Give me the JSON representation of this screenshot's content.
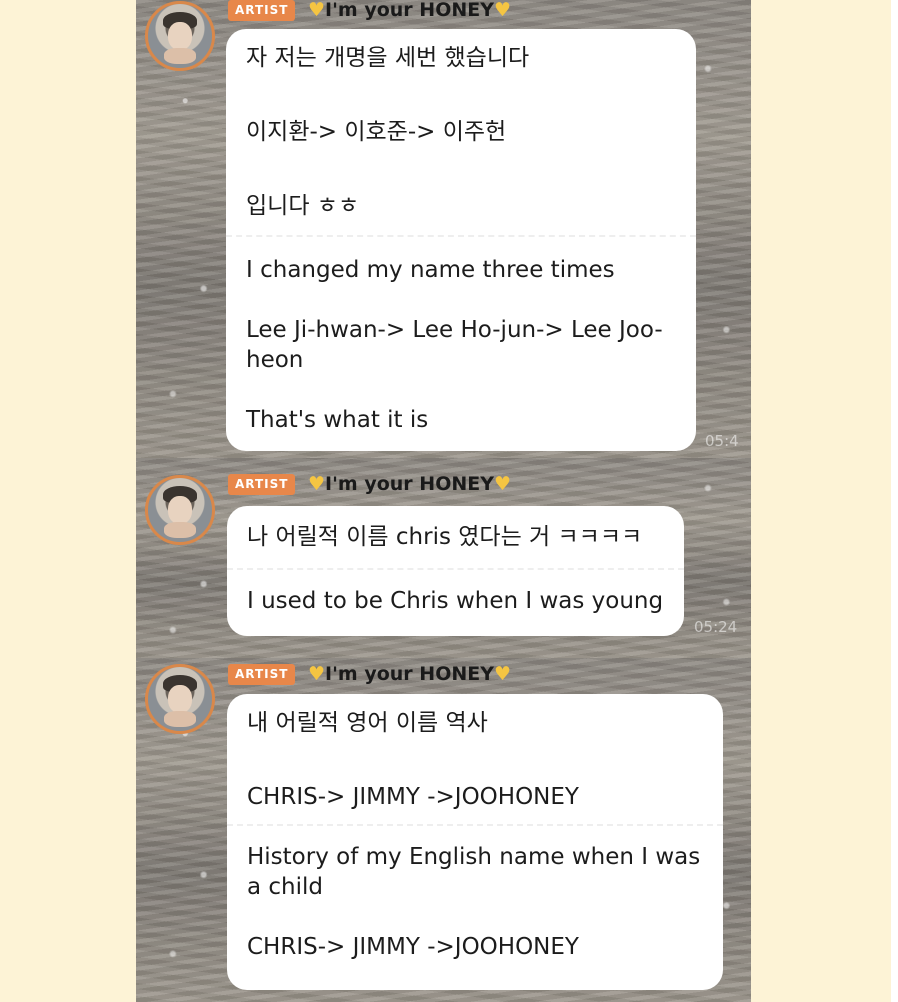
{
  "messages": [
    {
      "badge": "ARTIST",
      "sender_name": "I'm your HONEY",
      "heart_icon": "yellow-heart",
      "korean": [
        "자 저는 개명을 세번 했습니다",
        "이지환-> 이호준-> 이주헌",
        "입니다 ㅎㅎ"
      ],
      "english": [
        "I changed my name three times",
        "Lee Ji-hwan-> Lee Ho-jun-> Lee Joo-",
        "heon",
        "That's what it is"
      ],
      "time": "05:4"
    },
    {
      "badge": "ARTIST",
      "sender_name": "I'm your HONEY",
      "heart_icon": "yellow-heart",
      "korean": [
        "나 어릴적 이름 chris  였다는 거 ㅋㅋㅋㅋ"
      ],
      "english": [
        "I used to be Chris when I was young"
      ],
      "time": "05:24"
    },
    {
      "badge": "ARTIST",
      "sender_name": "I'm your HONEY",
      "heart_icon": "yellow-heart",
      "korean": [
        "내 어릴적 영어 이름 역사",
        "CHRIS-> JIMMY ->JOOHONEY"
      ],
      "english": [
        "History of my English name when I was",
        "a child",
        "CHRIS-> JIMMY ->JOOHONEY"
      ]
    }
  ],
  "colors": {
    "page_background": "#fdf3d6",
    "badge": "#e8874a",
    "heart": "#f5c542",
    "avatar_border": "#d9884a",
    "bubble": "#ffffff"
  }
}
